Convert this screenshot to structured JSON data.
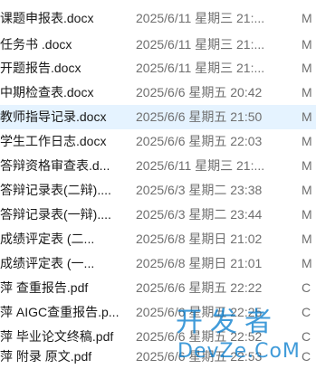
{
  "files": [
    {
      "name": "课题申报表.docx",
      "date": "2025/6/11 星期三 21:...",
      "type": "M"
    },
    {
      "name": "任务书 .docx",
      "date": "2025/6/11 星期三 21:...",
      "type": "M"
    },
    {
      "name": "开题报告.docx",
      "date": "2025/6/11 星期三 21:...",
      "type": "M"
    },
    {
      "name": "中期检查表.docx",
      "date": "2025/6/6 星期五 20:42",
      "type": "M"
    },
    {
      "name": "教师指导记录.docx",
      "date": "2025/6/6 星期五 21:50",
      "type": "M"
    },
    {
      "name": "学生工作日志.docx",
      "date": "2025/6/6 星期五 22:03",
      "type": "M"
    },
    {
      "name": "答辩资格审查表.d...",
      "date": "2025/6/11 星期三 21:...",
      "type": "M"
    },
    {
      "name": "答辩记录表(二辩)....",
      "date": "2025/6/3 星期二 23:38",
      "type": "M"
    },
    {
      "name": "答辩记录表(一辩)....",
      "date": "2025/6/3 星期二 23:44",
      "type": "M"
    },
    {
      "name": "成绩评定表 (二...",
      "date": "2025/6/8 星期日 21:02",
      "type": "M"
    },
    {
      "name": "成绩评定表 (一...",
      "date": "2025/6/8 星期日 21:01",
      "type": "M"
    },
    {
      "name": "萍 查重报告.pdf",
      "date": "2025/6/6 星期五 22:22",
      "type": "C"
    },
    {
      "name": "萍 AIGC查重报告.p...",
      "date": "2025/6/6 星期五 22:25",
      "type": "C"
    },
    {
      "name": "萍 毕业论文终稿.pdf",
      "date": "2025/6/6 星期五 22:52",
      "type": "C"
    },
    {
      "name": "萍 附录 原文.pdf",
      "date": "2025/6/6 星期五 22:53",
      "type": "C"
    }
  ],
  "watermark": {
    "cn": "开发者",
    "en": "DevZe.CoM"
  }
}
